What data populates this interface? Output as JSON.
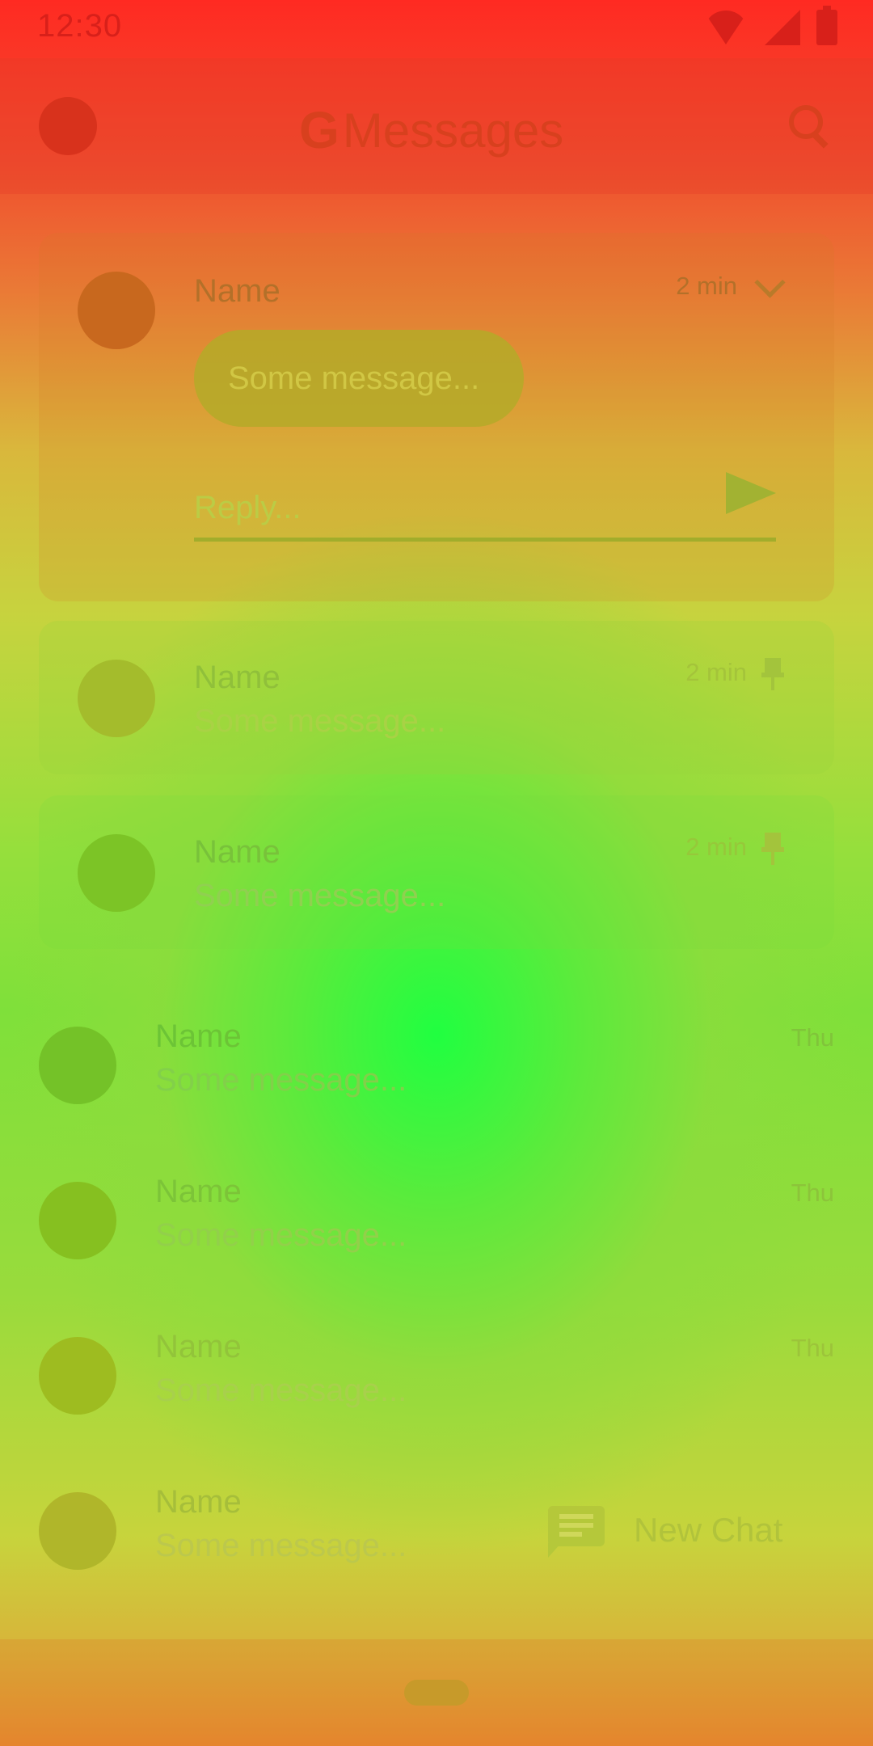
{
  "status_bar": {
    "time": "12:30",
    "icons": [
      "wifi-icon",
      "signal-icon",
      "battery-icon"
    ]
  },
  "app_bar": {
    "logo_letter": "G",
    "title": "Messages",
    "icons": [
      "avatar",
      "search-icon"
    ]
  },
  "expanded_card": {
    "name": "Name",
    "time": "2 min",
    "message": "Some message...",
    "reply_placeholder": "Reply..."
  },
  "pinned": [
    {
      "name": "Name",
      "message": "Some message...",
      "time": "2 min"
    },
    {
      "name": "Name",
      "message": "Some message...",
      "time": "2 min"
    }
  ],
  "conversations": [
    {
      "name": "Name",
      "message": "Some message...",
      "time": "Thu"
    },
    {
      "name": "Name",
      "message": "Some message...",
      "time": "Thu"
    },
    {
      "name": "Name",
      "message": "Some message...",
      "time": "Thu"
    },
    {
      "name": "Name",
      "message": "Some message...",
      "time": ""
    }
  ],
  "fab": {
    "label": "New Chat"
  },
  "colors": {
    "top": "#ff2a22",
    "middle": "#20ff40",
    "bottom": "#e88a30"
  }
}
